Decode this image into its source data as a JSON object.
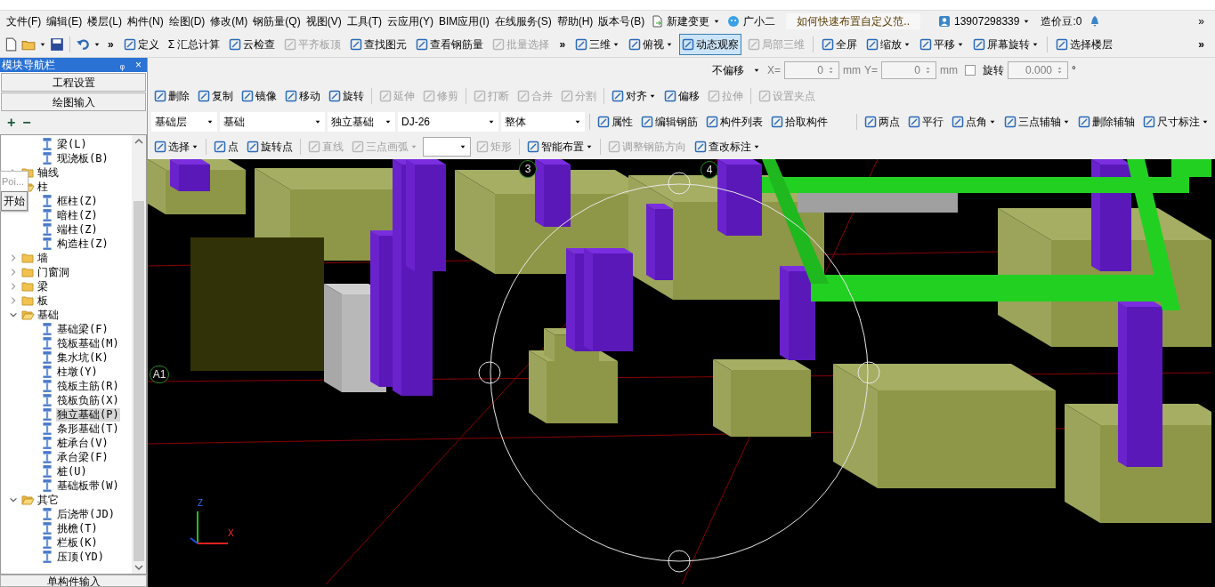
{
  "menu": [
    {
      "label": "文件(F)"
    },
    {
      "label": "编辑(E)"
    },
    {
      "label": "楼层(L)"
    },
    {
      "label": "构件(N)"
    },
    {
      "label": "绘图(D)"
    },
    {
      "label": "修改(M)"
    },
    {
      "label": "钢筋量(Q)"
    },
    {
      "label": "视图(V)"
    },
    {
      "label": "工具(T)"
    },
    {
      "label": "云应用(Y)"
    },
    {
      "label": "BIM应用(I)"
    },
    {
      "label": "在线服务(S)"
    },
    {
      "label": "帮助(H)"
    },
    {
      "label": "版本号(B)"
    }
  ],
  "menu_extras": {
    "new_change": "新建变更",
    "assistant": "广小二",
    "help_link": "如何快速布置自定义范..",
    "user": "13907298339",
    "beans": "造价豆:0",
    "overflow": "»"
  },
  "main_toolbar": [
    {
      "label": "»",
      "kind": "chevron"
    },
    {
      "label": "定义",
      "disabled": false,
      "dropdown": false,
      "kind": "tool"
    },
    {
      "label": "Σ 汇总计算",
      "disabled": false,
      "dropdown": false,
      "kind": "text"
    },
    {
      "label": "云检查",
      "disabled": false,
      "dropdown": false,
      "kind": "tool"
    },
    {
      "label": "平齐板顶",
      "disabled": true,
      "dropdown": false,
      "kind": "tool"
    },
    {
      "label": "查找图元",
      "disabled": false,
      "dropdown": false,
      "kind": "tool"
    },
    {
      "label": "查看钢筋量",
      "disabled": false,
      "dropdown": false,
      "kind": "tool"
    },
    {
      "label": "批量选择",
      "disabled": true,
      "dropdown": false,
      "kind": "tool"
    },
    {
      "label": "»",
      "kind": "chevron"
    }
  ],
  "view_toolbar": [
    {
      "label": "三维",
      "disabled": false,
      "dropdown": true,
      "selected": false
    },
    {
      "label": "俯视",
      "disabled": false,
      "dropdown": true,
      "selected": false
    },
    {
      "label": "动态观察",
      "disabled": false,
      "dropdown": false,
      "selected": true
    },
    {
      "label": "局部三维",
      "disabled": true,
      "dropdown": false,
      "selected": false
    },
    {
      "label": "全屏",
      "disabled": false,
      "dropdown": false,
      "selected": false
    },
    {
      "label": "缩放",
      "disabled": false,
      "dropdown": true,
      "selected": false
    },
    {
      "label": "平移",
      "disabled": false,
      "dropdown": true,
      "selected": false
    },
    {
      "label": "屏幕旋转",
      "disabled": false,
      "dropdown": true,
      "selected": false
    },
    {
      "label": "选择楼层",
      "disabled": false,
      "dropdown": false,
      "selected": false
    }
  ],
  "view_overflow": "»",
  "offset_bar": {
    "mode": "不偏移",
    "x_label": "X=",
    "x_value": "0",
    "x_unit": "mm",
    "y_label": "Y=",
    "y_value": "0",
    "y_unit": "mm",
    "rotate_checked": false,
    "rotate_label": "旋转",
    "rotate_value": "0.000",
    "degree": "°"
  },
  "edit_toolbar": [
    {
      "label": "删除",
      "disabled": false,
      "dropdown": false
    },
    {
      "label": "复制",
      "disabled": false,
      "dropdown": false
    },
    {
      "label": "镜像",
      "disabled": false,
      "dropdown": false
    },
    {
      "label": "移动",
      "disabled": false,
      "dropdown": false
    },
    {
      "label": "旋转",
      "disabled": false,
      "dropdown": false
    },
    {
      "label": "延伸",
      "disabled": true,
      "dropdown": false
    },
    {
      "label": "修剪",
      "disabled": true,
      "dropdown": false
    },
    {
      "label": "打断",
      "disabled": true,
      "dropdown": false
    },
    {
      "label": "合并",
      "disabled": true,
      "dropdown": false
    },
    {
      "label": "分割",
      "disabled": true,
      "dropdown": false
    },
    {
      "label": "对齐",
      "disabled": false,
      "dropdown": true
    },
    {
      "label": "偏移",
      "disabled": false,
      "dropdown": false
    },
    {
      "label": "拉伸",
      "disabled": true,
      "dropdown": false
    },
    {
      "label": "设置夹点",
      "disabled": true,
      "dropdown": false
    }
  ],
  "selector_bar": {
    "dropdowns": [
      "基础层",
      "基础",
      "独立基础",
      "DJ-26",
      "整体"
    ],
    "tools": [
      {
        "label": "属性",
        "disabled": false,
        "dropdown": false
      },
      {
        "label": "编辑钢筋",
        "disabled": false,
        "dropdown": false
      },
      {
        "label": "构件列表",
        "disabled": false,
        "dropdown": false
      },
      {
        "label": "拾取构件",
        "disabled": false,
        "dropdown": false
      }
    ],
    "axis_tools": [
      {
        "label": "两点",
        "disabled": false,
        "dropdown": false
      },
      {
        "label": "平行",
        "disabled": false,
        "dropdown": false
      },
      {
        "label": "点角",
        "disabled": false,
        "dropdown": true
      },
      {
        "label": "三点辅轴",
        "disabled": false,
        "dropdown": true
      },
      {
        "label": "删除辅轴",
        "disabled": false,
        "dropdown": false
      },
      {
        "label": "尺寸标注",
        "disabled": false,
        "dropdown": true
      }
    ]
  },
  "draw_toolbar": [
    {
      "label": "选择",
      "disabled": false,
      "dropdown": true,
      "kind": "tool"
    },
    {
      "label": "点",
      "disabled": false,
      "dropdown": false,
      "kind": "tool"
    },
    {
      "label": "旋转点",
      "disabled": false,
      "dropdown": false,
      "kind": "tool"
    },
    {
      "label": "直线",
      "disabled": true,
      "dropdown": false,
      "kind": "tool"
    },
    {
      "label": "三点画弧",
      "disabled": true,
      "dropdown": true,
      "kind": "tool"
    },
    {
      "kind": "combo",
      "dropdown": true
    },
    {
      "label": "矩形",
      "disabled": true,
      "dropdown": false,
      "kind": "tool"
    },
    {
      "label": "智能布置",
      "disabled": false,
      "dropdown": true,
      "kind": "tool"
    },
    {
      "label": "调整钢筋方向",
      "disabled": true,
      "dropdown": false,
      "kind": "tool"
    },
    {
      "label": "查改标注",
      "disabled": false,
      "dropdown": true,
      "kind": "tool"
    }
  ],
  "nav_panel": {
    "title": "模块导航栏",
    "pin": "ᵩ",
    "close": "×",
    "sections": [
      "工程设置",
      "绘图输入"
    ],
    "expand_all": "+",
    "collapse_all": "−",
    "tree": [
      {
        "children": [
          {
            "label": "梁(L)",
            "selected": false
          },
          {
            "label": "现浇板(B)",
            "selected": false
          }
        ]
      },
      {
        "label": "轴线",
        "expanded": false,
        "selected": false
      },
      {
        "label": "柱",
        "expanded": true,
        "selected": false,
        "children": [
          {
            "label": "框柱(Z)",
            "selected": false
          },
          {
            "label": "暗柱(Z)",
            "selected": false
          },
          {
            "label": "端柱(Z)",
            "selected": false
          },
          {
            "label": "构造柱(Z)",
            "selected": false
          }
        ]
      },
      {
        "label": "墙",
        "expanded": false,
        "selected": false
      },
      {
        "label": "门窗洞",
        "expanded": false,
        "selected": false
      },
      {
        "label": "梁",
        "expanded": false,
        "selected": false
      },
      {
        "label": "板",
        "expanded": false,
        "selected": false
      },
      {
        "label": "基础",
        "expanded": true,
        "selected": false,
        "children": [
          {
            "label": "基础梁(F)",
            "selected": false
          },
          {
            "label": "筏板基础(M)",
            "selected": false
          },
          {
            "label": "集水坑(K)",
            "selected": false
          },
          {
            "label": "柱墩(Y)",
            "selected": false
          },
          {
            "label": "筏板主筋(R)",
            "selected": false
          },
          {
            "label": "筏板负筋(X)",
            "selected": false
          },
          {
            "label": "独立基础(P)",
            "selected": true
          },
          {
            "label": "条形基础(T)",
            "selected": false
          },
          {
            "label": "桩承台(V)",
            "selected": false
          },
          {
            "label": "承台梁(F)",
            "selected": false
          },
          {
            "label": "桩(U)",
            "selected": false
          },
          {
            "label": "基础板带(W)",
            "selected": false
          }
        ]
      },
      {
        "label": "其它",
        "expanded": true,
        "selected": false,
        "children": [
          {
            "label": "后浇带(JD)",
            "selected": false
          },
          {
            "label": "挑檐(T)",
            "selected": false
          },
          {
            "label": "栏板(K)",
            "selected": false
          },
          {
            "label": "压顶(YD)",
            "selected": false
          }
        ]
      }
    ],
    "bottom_section": "单构件输入"
  },
  "popup": {
    "text": "Poi...",
    "button": "开始"
  },
  "viewport": {
    "axis_labels": [
      "3",
      "4",
      "A1"
    ],
    "triad": [
      "Z",
      "X"
    ]
  }
}
